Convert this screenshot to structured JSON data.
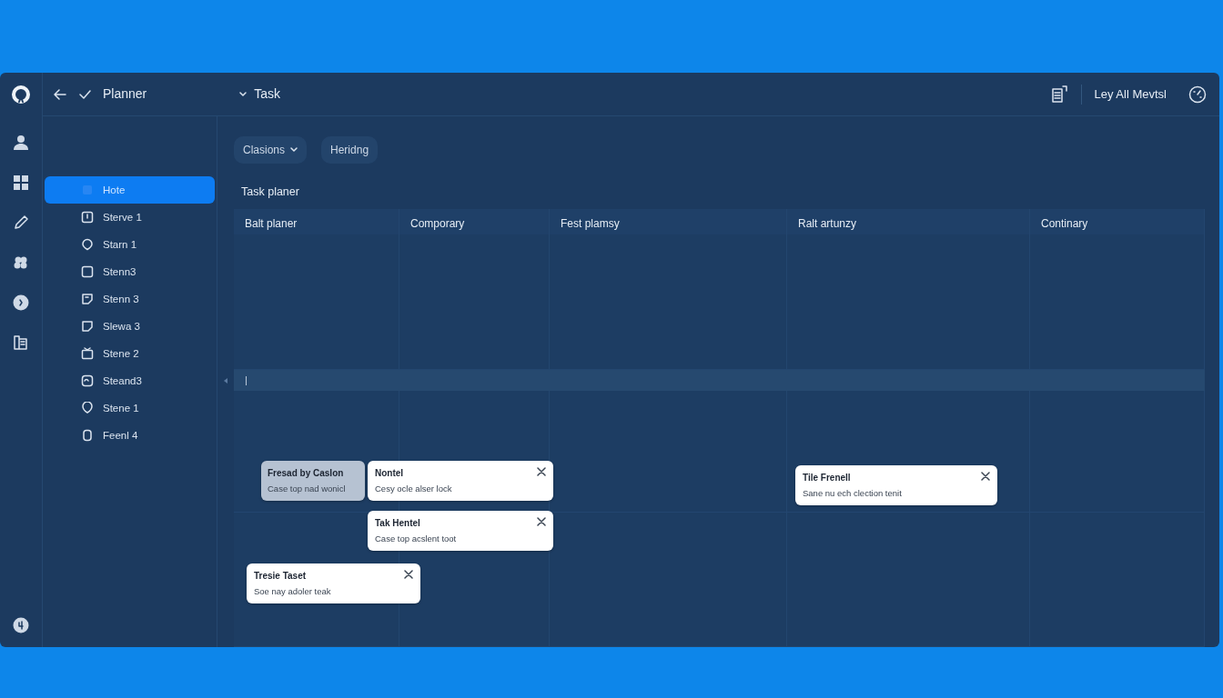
{
  "topbar": {
    "title": "Planner",
    "section": "Task",
    "account": "Ley All Mevtsl"
  },
  "sidebar": {
    "items": [
      {
        "label": "Hote",
        "selected": true
      },
      {
        "label": "Sterve 1",
        "selected": false
      },
      {
        "label": "Starn 1",
        "selected": false
      },
      {
        "label": "Stenn3",
        "selected": false
      },
      {
        "label": "Stenn 3",
        "selected": false
      },
      {
        "label": "Slewa 3",
        "selected": false
      },
      {
        "label": "Stene 2",
        "selected": false
      },
      {
        "label": "Steand3",
        "selected": false
      },
      {
        "label": "Stene 1",
        "selected": false
      },
      {
        "label": "Feenl 4",
        "selected": false
      }
    ]
  },
  "filters": [
    {
      "label": "Clasions",
      "dropdown": true
    },
    {
      "label": "Heridng",
      "dropdown": false
    }
  ],
  "board": {
    "title": "Task planer",
    "columns": [
      "Balt planer",
      "Comporary",
      "Fest plamsy",
      "Ralt artunzy",
      "Continary"
    ],
    "row_marker": "|",
    "cards": [
      {
        "title": "Fresad by Caslon",
        "text": "Case top nad wonicl",
        "dimmed": true
      },
      {
        "title": "Nontel",
        "text": "Cesy ocle alser lock",
        "dimmed": false
      },
      {
        "title": "Tak Hentel",
        "text": "Case top acslent toot",
        "dimmed": false
      },
      {
        "title": "Tresie Taset",
        "text": "Soe nay adoler teak",
        "dimmed": false
      },
      {
        "title": "Tile Frenell",
        "text": "Sane nu ech clection tenit",
        "dimmed": false
      }
    ]
  }
}
